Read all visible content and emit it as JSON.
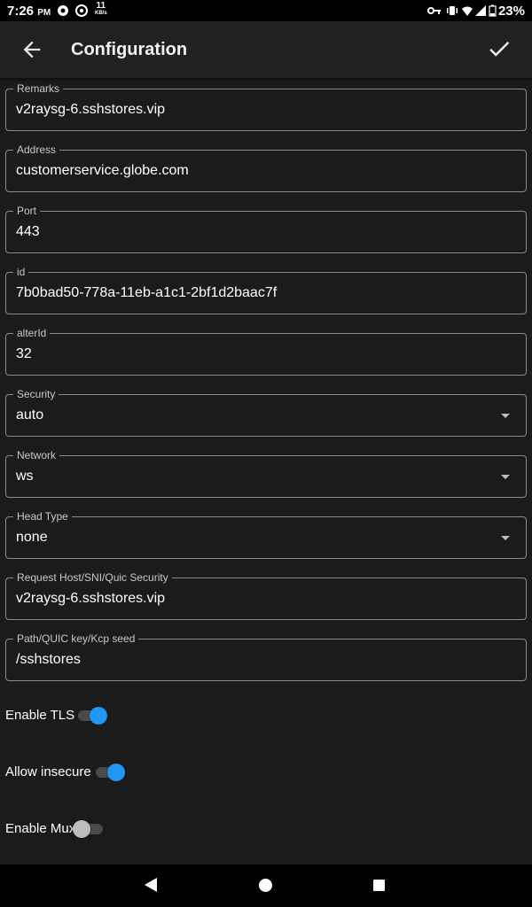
{
  "status_bar": {
    "time": "7:26",
    "ampm": "PM",
    "net_speed": "11",
    "net_unit": "KB/s",
    "battery": "23%"
  },
  "app_bar": {
    "title": "Configuration",
    "back_icon": "arrow-back-icon",
    "save_icon": "check-icon"
  },
  "fields": {
    "remarks": {
      "label": "Remarks",
      "value": "v2raysg-6.sshstores.vip"
    },
    "address": {
      "label": "Address",
      "value": "customerservice.globe.com"
    },
    "port": {
      "label": "Port",
      "value": "443"
    },
    "id": {
      "label": "id",
      "value": "7b0bad50-778a-11eb-a1c1-2bf1d2baac7f"
    },
    "alter_id": {
      "label": "alterId",
      "value": "32"
    },
    "security": {
      "label": "Security",
      "value": "auto"
    },
    "network": {
      "label": "Network",
      "value": "ws"
    },
    "head_type": {
      "label": "Head Type",
      "value": "none"
    },
    "request_host": {
      "label": "Request Host/SNI/Quic Security",
      "value": "v2raysg-6.sshstores.vip"
    },
    "path": {
      "label": "Path/QUIC key/Kcp seed",
      "value": "/sshstores"
    }
  },
  "toggles": {
    "enable_tls": {
      "label": "Enable TLS",
      "on": true
    },
    "allow_insecure": {
      "label": "Allow insecure",
      "on": true
    },
    "enable_mux": {
      "label": "Enable Mux",
      "on": false
    }
  },
  "colors": {
    "accent": "#2196f3",
    "background": "#1b1b1b",
    "app_bar": "#212121"
  }
}
